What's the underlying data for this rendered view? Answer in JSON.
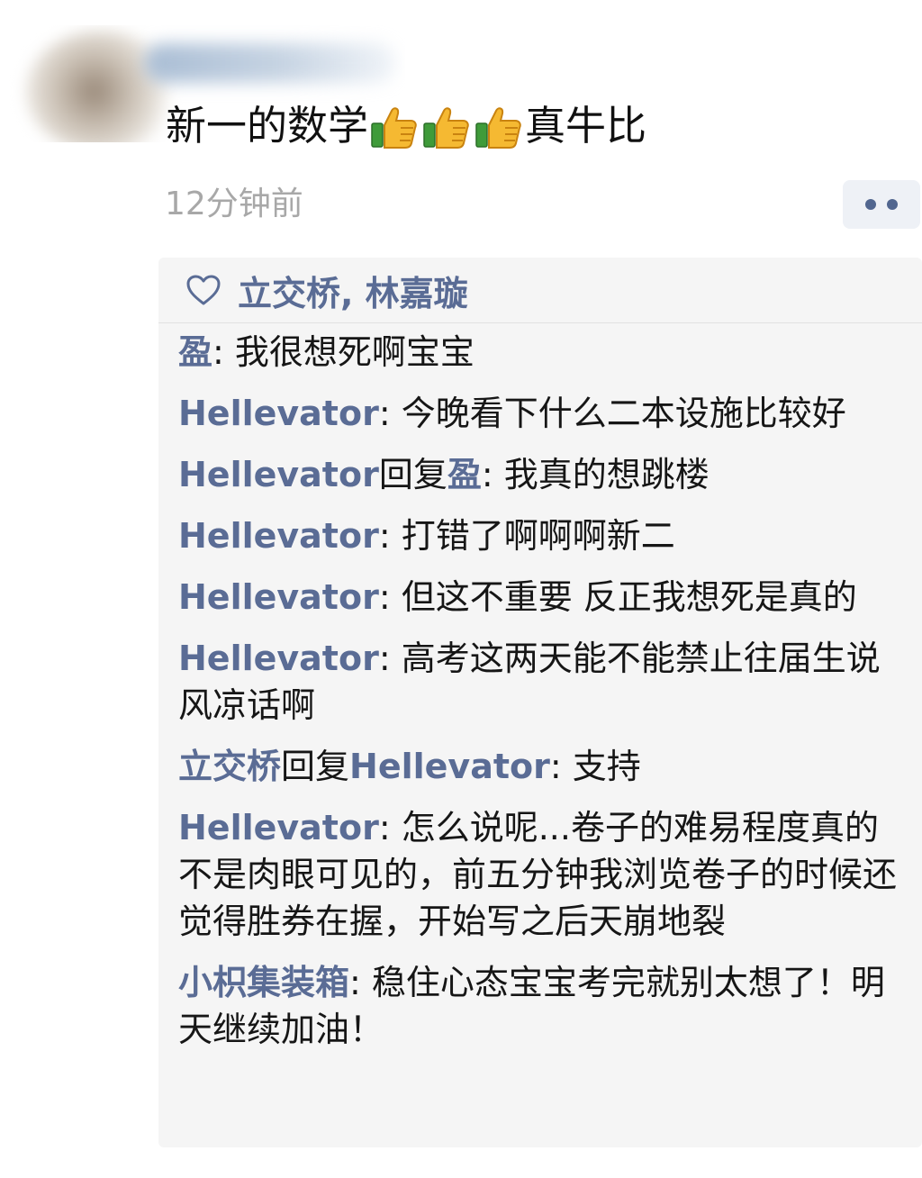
{
  "post": {
    "text_before": "新一的数学",
    "text_after": "真牛比",
    "emojis": [
      "thumbs-up",
      "thumbs-up",
      "thumbs-up"
    ],
    "time": "12分钟前"
  },
  "more_button": {
    "icon": "more-dots-icon"
  },
  "likes": {
    "icon": "heart-outline-icon",
    "names": "立交桥, 林嘉璇"
  },
  "comments": [
    {
      "author": "盈",
      "reply_word": "",
      "reply_to": "",
      "sep": ": ",
      "text": "我很想死啊宝宝"
    },
    {
      "author": "Hellevator",
      "reply_word": "",
      "reply_to": "",
      "sep": ": ",
      "text": "今晚看下什么二本设施比较好"
    },
    {
      "author": "Hellevator",
      "reply_word": "回复",
      "reply_to": "盈",
      "sep": ": ",
      "text": "我真的想跳楼"
    },
    {
      "author": "Hellevator",
      "reply_word": "",
      "reply_to": "",
      "sep": ": ",
      "text": "打错了啊啊啊新二"
    },
    {
      "author": "Hellevator",
      "reply_word": "",
      "reply_to": "",
      "sep": ": ",
      "text": "但这不重要 反正我想死是真的"
    },
    {
      "author": "Hellevator",
      "reply_word": "",
      "reply_to": "",
      "sep": ": ",
      "text": "高考这两天能不能禁止往届生说风凉话啊"
    },
    {
      "author": "立交桥",
      "reply_word": "回复",
      "reply_to": "Hellevator",
      "sep": ": ",
      "text": "支持"
    },
    {
      "author": "Hellevator",
      "reply_word": "",
      "reply_to": "",
      "sep": ": ",
      "text": "怎么说呢...卷子的难易程度真的不是肉眼可见的，前五分钟我浏览卷子的时候还觉得胜券在握，开始写之后天崩地裂"
    },
    {
      "author": "小枳集装箱",
      "reply_word": "",
      "reply_to": "",
      "sep": ": ",
      "text": "稳住心态宝宝考完就别太想了！明天继续加油！"
    }
  ],
  "colors": {
    "nickname": "#5a6c95",
    "timestamp": "#a8a8a8",
    "comment_bg": "#f5f5f5"
  }
}
